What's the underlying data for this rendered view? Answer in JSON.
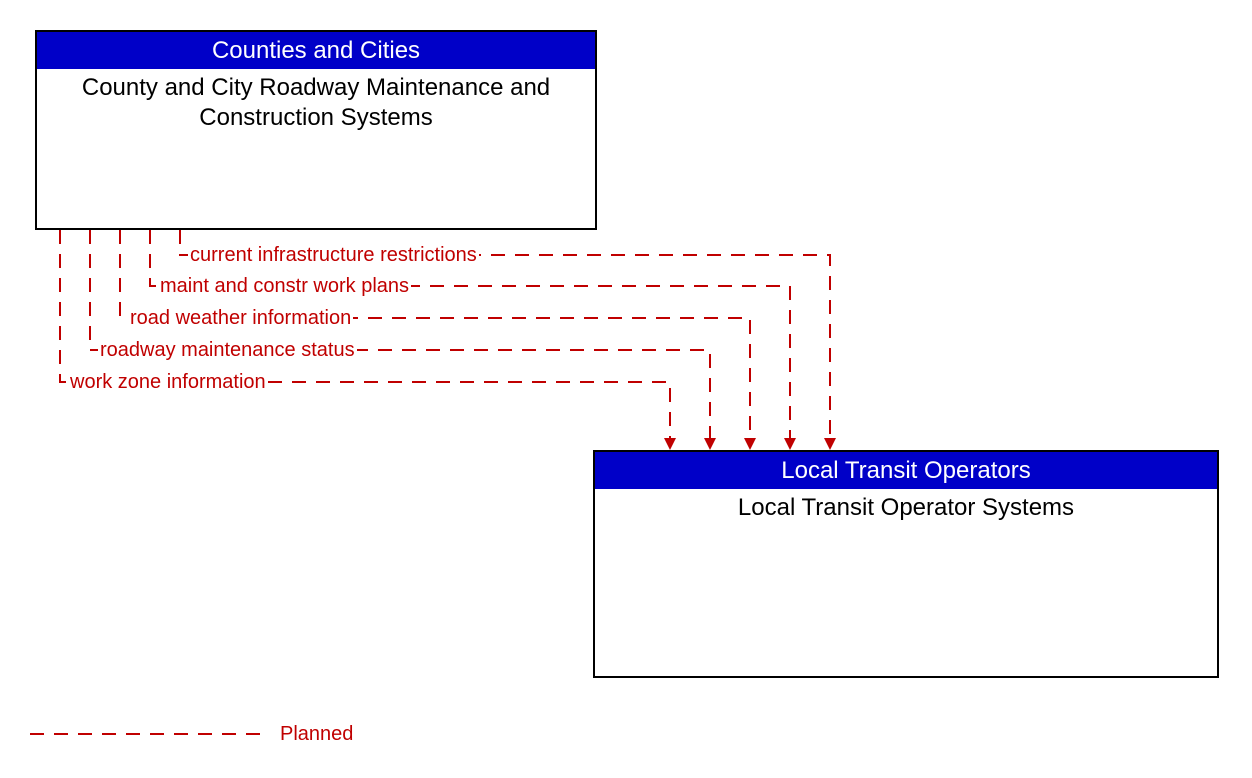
{
  "entities": {
    "source": {
      "header": "Counties and Cities",
      "body": "County and City Roadway Maintenance and Construction Systems"
    },
    "target": {
      "header": "Local Transit Operators",
      "body": "Local Transit Operator Systems"
    }
  },
  "flows": [
    "current infrastructure restrictions",
    "maint and constr work plans",
    "road weather information",
    "roadway maintenance status",
    "work zone information"
  ],
  "legend": {
    "planned": "Planned"
  },
  "colors": {
    "header_bg": "#0000c8",
    "flow": "#c00000"
  }
}
